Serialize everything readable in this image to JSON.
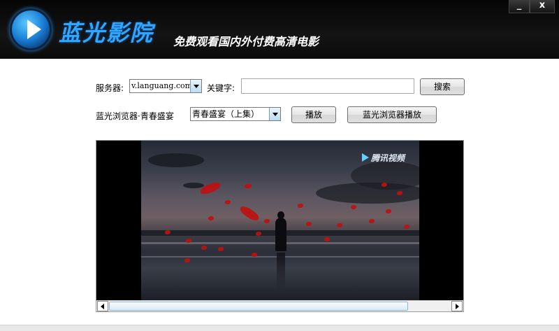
{
  "header": {
    "app_name": "蓝光影院",
    "slogan": "免费观看国内外付费高清电影",
    "logo_icon": "play-circle-icon",
    "minimize_label": "_",
    "close_label": "x"
  },
  "search_row": {
    "server_label": "服务器:",
    "server_value": "v.languang.com",
    "keyword_label": "关键字:",
    "keyword_value": "",
    "search_button": "搜索"
  },
  "play_row": {
    "now_playing": "蓝光浏览器·青春盛宴",
    "episode_value": "青春盛宴（上集）",
    "play_button": "播放",
    "browser_play_button": "蓝光浏览器播放"
  },
  "video": {
    "watermark": "腾讯视频"
  },
  "colors": {
    "header_bg": "#0b0b0b",
    "app_name": "#2fa6ff",
    "petal": "#c01010"
  }
}
